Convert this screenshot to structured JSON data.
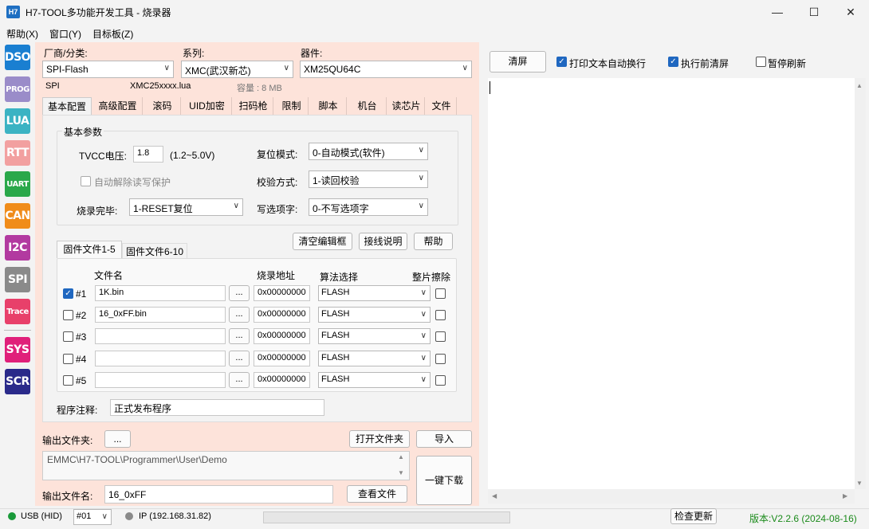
{
  "window": {
    "icon_text": "H7",
    "title": "H7-TOOL多功能开发工具 - 烧录器"
  },
  "menu": [
    "帮助(X)",
    "窗口(Y)",
    "目标板(Z)"
  ],
  "sidebar": [
    {
      "label": "DSO",
      "color": "#1a7fd1"
    },
    {
      "label": "PROG",
      "color": "#9a8cc9"
    },
    {
      "label": "LUA",
      "color": "#3bb3c3"
    },
    {
      "label": "RTT",
      "color": "#f2a0a0"
    },
    {
      "label": "UART",
      "color": "#2aa84a"
    },
    {
      "label": "CAN",
      "color": "#f08c1a"
    },
    {
      "label": "I2C",
      "color": "#b23aa0"
    },
    {
      "label": "SPI",
      "color": "#8a8a8a"
    },
    {
      "label": "Trace",
      "color": "#e8406a"
    },
    {
      "label": "SYS",
      "color": "#e0207a"
    },
    {
      "label": "SCR",
      "color": "#2a2a8a"
    }
  ],
  "device": {
    "vendor_label": "厂商/分类:",
    "vendor_value": "SPI-Flash",
    "series_label": "系列:",
    "series_value": "XMC(武汉新芯)",
    "device_label": "器件:",
    "device_value": "XM25QU64C",
    "info_type": "SPI",
    "info_lua": "XMC25xxxx.lua",
    "info_capacity": "容量 : 8 MB"
  },
  "tabs": [
    "基本配置",
    "高级配置",
    "滚码",
    "UID加密",
    "扫码枪",
    "限制",
    "脚本",
    "机台",
    "读芯片",
    "文件"
  ],
  "basic": {
    "group_title": "基本参数",
    "tvcc_label": "TVCC电压:",
    "tvcc_value": "1.8",
    "tvcc_range": "(1.2~5.0V)",
    "reset_label": "复位模式:",
    "reset_value": "0-自动模式(软件)",
    "auto_unprotect": "自动解除读写保护",
    "verify_label": "校验方式:",
    "verify_value": "1-读回校验",
    "done_label": "烧录完毕:",
    "done_value": "1-RESET复位",
    "option_label": "写选项字:",
    "option_value": "0-不写选项字"
  },
  "buttons": {
    "clear_editor": "清空编辑框",
    "wiring": "接线说明",
    "help": "帮助",
    "browse": "...",
    "open_folder": "打开文件夹",
    "import": "导入",
    "view_file": "查看文件",
    "one_click": "一键下载"
  },
  "file_tabs": [
    "固件文件1-5",
    "固件文件6-10"
  ],
  "file_headers": {
    "name": "文件名",
    "address": "烧录地址",
    "algo": "算法选择",
    "erase": "整片擦除"
  },
  "files": [
    {
      "id": "#1",
      "checked": true,
      "name": "1K.bin",
      "address": "0x00000000",
      "algo": "FLASH"
    },
    {
      "id": "#2",
      "checked": false,
      "name": "16_0xFF.bin",
      "address": "0x00000000",
      "algo": "FLASH"
    },
    {
      "id": "#3",
      "checked": false,
      "name": "",
      "address": "0x00000000",
      "algo": "FLASH"
    },
    {
      "id": "#4",
      "checked": false,
      "name": "",
      "address": "0x00000000",
      "algo": "FLASH"
    },
    {
      "id": "#5",
      "checked": false,
      "name": "",
      "address": "0x00000000",
      "algo": "FLASH"
    }
  ],
  "comment": {
    "label": "程序注释:",
    "value": "正式发布程序"
  },
  "output": {
    "folder_label": "输出文件夹:",
    "path": "EMMC\\H7-TOOL\\Programmer\\User\\Demo",
    "name_label": "输出文件名:",
    "name_value": "16_0xFF"
  },
  "right": {
    "clear_label": "清屏",
    "wrap_label": "打印文本自动换行",
    "wrap_checked": true,
    "clear_before_label": "执行前清屏",
    "clear_before_checked": true,
    "pause_label": "暂停刷新",
    "pause_checked": false
  },
  "status": {
    "usb": "USB (HID)",
    "port": "#01",
    "ip": "IP (192.168.31.82)",
    "update": "检查更新",
    "version": "版本:V2.2.6 (2024-08-16)",
    "usb_color": "#1a9a3a",
    "version_color": "#1a8a1a"
  }
}
